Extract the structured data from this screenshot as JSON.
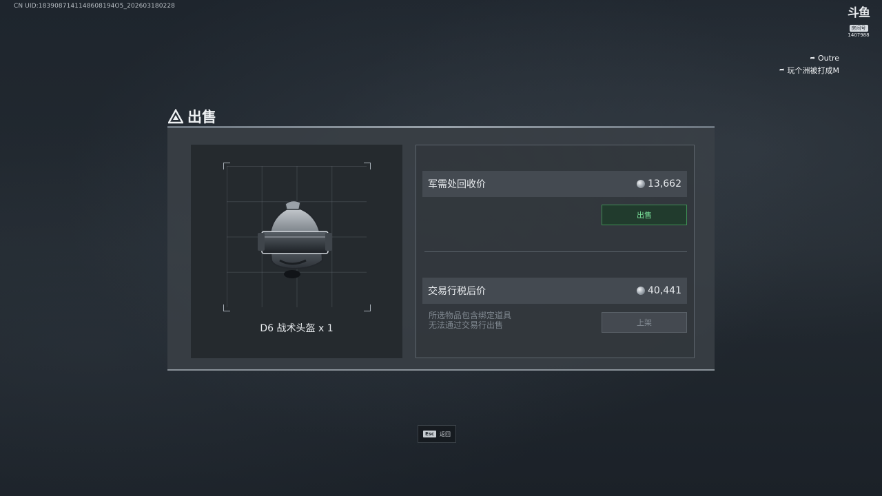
{
  "overlay": {
    "uid": "CN UID:1839087141148608194O5_202603180228",
    "douyu_logo": "斗鱼",
    "douyu_tag": "房间号",
    "room_number": "1407988",
    "followers": [
      "Outre",
      "玩个洲被打成M"
    ]
  },
  "dialog": {
    "title": "出售",
    "item_name": "D6 战术头盔 x 1",
    "recycle": {
      "label": "军需处回收价",
      "value": "13,662",
      "button": "出售"
    },
    "market": {
      "label": "交易行税后价",
      "value": "40,441",
      "note_line1": "所选物品包含绑定道具",
      "note_line2": "无法通过交易行出售",
      "button": "上架"
    }
  },
  "footer": {
    "key": "Esc",
    "label": "返回"
  },
  "colors": {
    "sell_accent": "#7be39b",
    "panel": "#3a4046"
  }
}
